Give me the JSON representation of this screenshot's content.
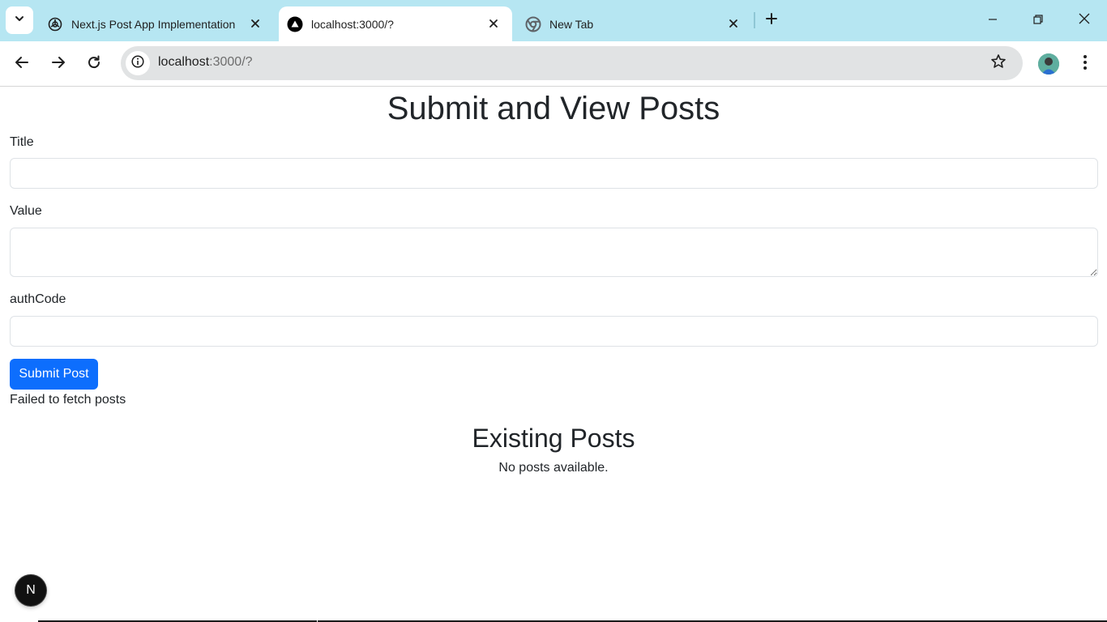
{
  "browser": {
    "tabs": [
      {
        "title": "Next.js Post App Implementation",
        "icon": "openai-icon"
      },
      {
        "title": "localhost:3000/?",
        "icon": "vercel-triangle-icon",
        "active": true
      },
      {
        "title": "New Tab",
        "icon": "chrome-icon"
      }
    ],
    "address": {
      "host": "localhost",
      "path": ":3000/?"
    }
  },
  "page": {
    "title": "Submit and View Posts",
    "form": {
      "title_label": "Title",
      "title_value": "",
      "value_label": "Value",
      "value_value": "",
      "authcode_label": "authCode",
      "authcode_value": "",
      "submit_label": "Submit Post"
    },
    "error_message": "Failed to fetch posts",
    "posts_heading": "Existing Posts",
    "empty_message": "No posts available.",
    "dev_indicator": "N"
  },
  "colors": {
    "tabstrip": "#b6e6f2",
    "primary_button": "#0d6efd",
    "text": "#212529"
  }
}
